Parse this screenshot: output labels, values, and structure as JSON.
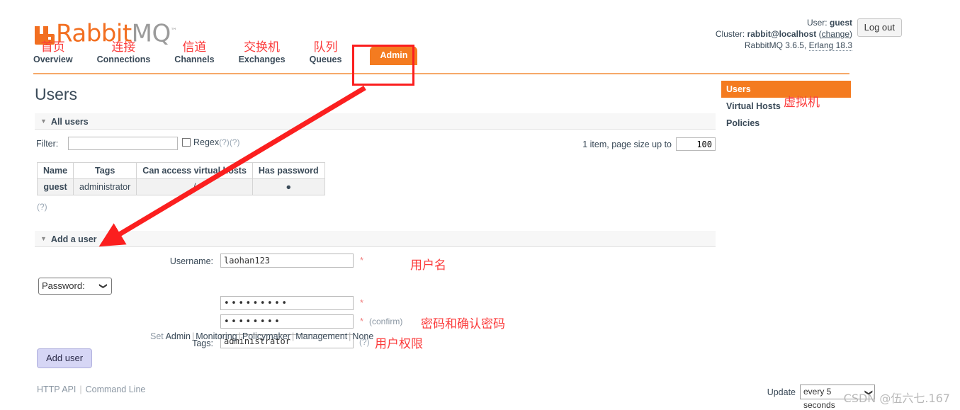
{
  "brand": {
    "name_rabbit": "Rabbit",
    "name_mq": "MQ",
    "tm": "™",
    "logo_icon": "rabbitmq-logo-icon",
    "accent_color": "#f26f21",
    "tab_color": "#f47b20",
    "annotation_color": "#fb3b3b"
  },
  "nav": {
    "items": [
      {
        "cn": "首页",
        "en": "Overview",
        "active": false
      },
      {
        "cn": "连接",
        "en": "Connections",
        "active": false
      },
      {
        "cn": "信道",
        "en": "Channels",
        "active": false
      },
      {
        "cn": "交换机",
        "en": "Exchanges",
        "active": false
      },
      {
        "cn": "队列",
        "en": "Queues",
        "active": false
      }
    ],
    "admin_tab": "Admin"
  },
  "userinfo": {
    "user_label": "User:",
    "user_value": "guest",
    "cluster_label": "Cluster:",
    "cluster_value": "rabbit@localhost",
    "change_link": "change",
    "version": "RabbitMQ 3.6.5, ",
    "erlang": "Erlang 18.3",
    "logout": "Log out"
  },
  "page": {
    "title": "Users"
  },
  "sidebar": {
    "items": [
      {
        "label": "Users",
        "active": true,
        "annotation": ""
      },
      {
        "label": "Virtual Hosts",
        "active": false,
        "annotation": "虚拟机"
      },
      {
        "label": "Policies",
        "active": false,
        "annotation": ""
      }
    ]
  },
  "all_users_section": {
    "header": "All users",
    "caret": "▼",
    "filter_label": "Filter:",
    "filter_value": "",
    "filter_placeholder": "",
    "regex_label": "Regex",
    "regex_help": "(?)",
    "regex_help2": "(?)",
    "regex_checked": false,
    "pagesize_text": "1 item, page size up to",
    "pagesize_value": "100",
    "table_help": "(?)"
  },
  "users_table": {
    "columns": [
      "Name",
      "Tags",
      "Can access virtual hosts",
      "Has password"
    ],
    "rows": [
      {
        "name": "guest",
        "tags": "administrator",
        "vhosts": "/",
        "has_password": "●"
      }
    ]
  },
  "add_user_section": {
    "header": "Add a user",
    "caret": "▼",
    "username_label": "Username:",
    "username_value": "laohan123",
    "username_required": "*",
    "username_annotation": "用户名",
    "password_select_label": "Password:",
    "password_select_caret": "❯",
    "password_value": "•••••••••",
    "password_confirm_value": "••••••••",
    "password_required": "*",
    "confirm_required": "*",
    "confirm_note": "(confirm)",
    "password_annotation": "密码和确认密码",
    "tags_label": "Tags:",
    "tags_value": "administrator",
    "tags_help": "(?)",
    "tags_annotation": "用户权限",
    "set_word": "Set",
    "set_links": [
      "Admin",
      "Monitoring",
      "Policymaker",
      "Management",
      "None"
    ],
    "separator": "|",
    "add_button": "Add user"
  },
  "footer": {
    "http_api": "HTTP API",
    "command_line": "Command Line",
    "separator": "|",
    "update_label": "Update",
    "update_value": "every 5 seconds",
    "update_caret": "❯"
  },
  "annotations": {
    "admin_box": "admin-tab-highlight-box",
    "arrow": "arrow-admin-to-add-user",
    "arrow_color": "#fb1f1f"
  },
  "watermark": {
    "text": "CSDN @伍六七.167"
  }
}
